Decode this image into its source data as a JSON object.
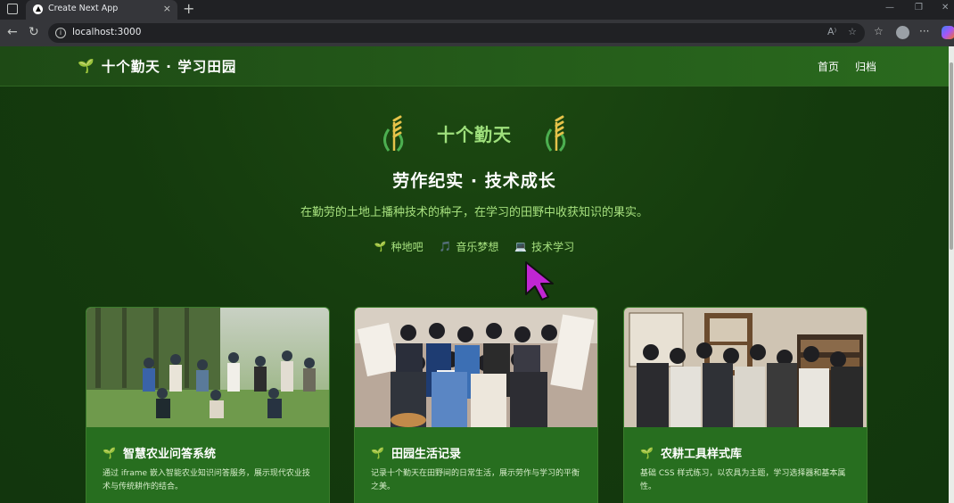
{
  "browser": {
    "tab_title": "Create Next App",
    "tab_close": "×",
    "new_tab": "+",
    "url": "localhost:3000",
    "reader_icon": "A⁾",
    "window_minimize": "—",
    "window_restore": "❐",
    "window_close": "✕"
  },
  "header": {
    "brand_icon": "🌱",
    "brand": "十个勤天 · 学习田园",
    "nav": [
      "首页",
      "归档"
    ]
  },
  "hero": {
    "title": "十个勤天",
    "subtitle": "劳作纪实 · 技术成长",
    "description": "在勤劳的土地上播种技术的种子，在学习的田野中收获知识的果实。",
    "tags": [
      {
        "icon": "🌱",
        "label": "种地吧"
      },
      {
        "icon": "🎵",
        "label": "音乐梦想"
      },
      {
        "icon": "💻",
        "label": "技术学习"
      }
    ]
  },
  "cards": [
    {
      "icon": "🌱",
      "title": "智慧农业问答系统",
      "description": "通过 iframe 嵌入智能农业知识问答服务，展示现代农业技术与传统耕作的结合。"
    },
    {
      "icon": "🌱",
      "title": "田园生活记录",
      "description": "记录十个勤天在田野间的日常生活，展示劳作与学习的平衡之美。"
    },
    {
      "icon": "🌱",
      "title": "农耕工具样式库",
      "description": "基础 CSS 样式练习，以农具为主题，学习选择器和基本属性。"
    }
  ],
  "colors": {
    "page_bg": "#143a0d",
    "header_bg": "#2a6a1e",
    "accent_green": "#9ee07c",
    "wheat_gold": "#e6c34a",
    "card_bg": "#276e1f",
    "cursor": "#c026d3"
  }
}
